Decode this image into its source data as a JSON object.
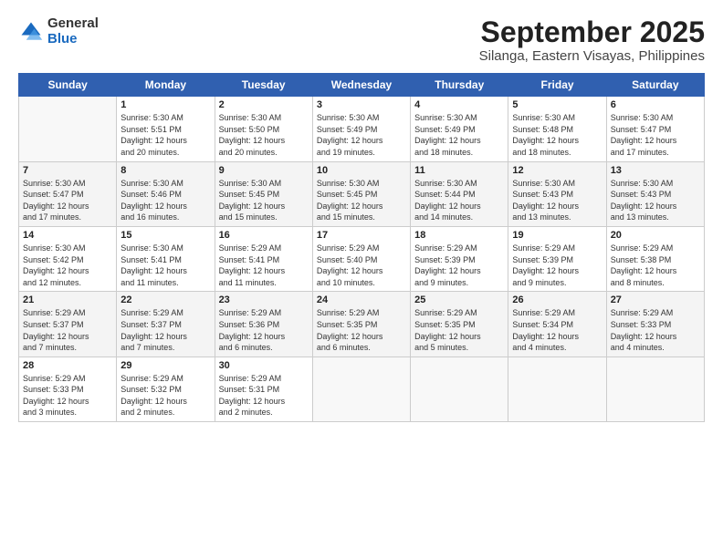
{
  "logo": {
    "general": "General",
    "blue": "Blue"
  },
  "title": "September 2025",
  "subtitle": "Silanga, Eastern Visayas, Philippines",
  "headers": [
    "Sunday",
    "Monday",
    "Tuesday",
    "Wednesday",
    "Thursday",
    "Friday",
    "Saturday"
  ],
  "weeks": [
    [
      {
        "day": "",
        "info": ""
      },
      {
        "day": "1",
        "info": "Sunrise: 5:30 AM\nSunset: 5:51 PM\nDaylight: 12 hours\nand 20 minutes."
      },
      {
        "day": "2",
        "info": "Sunrise: 5:30 AM\nSunset: 5:50 PM\nDaylight: 12 hours\nand 20 minutes."
      },
      {
        "day": "3",
        "info": "Sunrise: 5:30 AM\nSunset: 5:49 PM\nDaylight: 12 hours\nand 19 minutes."
      },
      {
        "day": "4",
        "info": "Sunrise: 5:30 AM\nSunset: 5:49 PM\nDaylight: 12 hours\nand 18 minutes."
      },
      {
        "day": "5",
        "info": "Sunrise: 5:30 AM\nSunset: 5:48 PM\nDaylight: 12 hours\nand 18 minutes."
      },
      {
        "day": "6",
        "info": "Sunrise: 5:30 AM\nSunset: 5:47 PM\nDaylight: 12 hours\nand 17 minutes."
      }
    ],
    [
      {
        "day": "7",
        "info": "Sunrise: 5:30 AM\nSunset: 5:47 PM\nDaylight: 12 hours\nand 17 minutes."
      },
      {
        "day": "8",
        "info": "Sunrise: 5:30 AM\nSunset: 5:46 PM\nDaylight: 12 hours\nand 16 minutes."
      },
      {
        "day": "9",
        "info": "Sunrise: 5:30 AM\nSunset: 5:45 PM\nDaylight: 12 hours\nand 15 minutes."
      },
      {
        "day": "10",
        "info": "Sunrise: 5:30 AM\nSunset: 5:45 PM\nDaylight: 12 hours\nand 15 minutes."
      },
      {
        "day": "11",
        "info": "Sunrise: 5:30 AM\nSunset: 5:44 PM\nDaylight: 12 hours\nand 14 minutes."
      },
      {
        "day": "12",
        "info": "Sunrise: 5:30 AM\nSunset: 5:43 PM\nDaylight: 12 hours\nand 13 minutes."
      },
      {
        "day": "13",
        "info": "Sunrise: 5:30 AM\nSunset: 5:43 PM\nDaylight: 12 hours\nand 13 minutes."
      }
    ],
    [
      {
        "day": "14",
        "info": "Sunrise: 5:30 AM\nSunset: 5:42 PM\nDaylight: 12 hours\nand 12 minutes."
      },
      {
        "day": "15",
        "info": "Sunrise: 5:30 AM\nSunset: 5:41 PM\nDaylight: 12 hours\nand 11 minutes."
      },
      {
        "day": "16",
        "info": "Sunrise: 5:29 AM\nSunset: 5:41 PM\nDaylight: 12 hours\nand 11 minutes."
      },
      {
        "day": "17",
        "info": "Sunrise: 5:29 AM\nSunset: 5:40 PM\nDaylight: 12 hours\nand 10 minutes."
      },
      {
        "day": "18",
        "info": "Sunrise: 5:29 AM\nSunset: 5:39 PM\nDaylight: 12 hours\nand 9 minutes."
      },
      {
        "day": "19",
        "info": "Sunrise: 5:29 AM\nSunset: 5:39 PM\nDaylight: 12 hours\nand 9 minutes."
      },
      {
        "day": "20",
        "info": "Sunrise: 5:29 AM\nSunset: 5:38 PM\nDaylight: 12 hours\nand 8 minutes."
      }
    ],
    [
      {
        "day": "21",
        "info": "Sunrise: 5:29 AM\nSunset: 5:37 PM\nDaylight: 12 hours\nand 7 minutes."
      },
      {
        "day": "22",
        "info": "Sunrise: 5:29 AM\nSunset: 5:37 PM\nDaylight: 12 hours\nand 7 minutes."
      },
      {
        "day": "23",
        "info": "Sunrise: 5:29 AM\nSunset: 5:36 PM\nDaylight: 12 hours\nand 6 minutes."
      },
      {
        "day": "24",
        "info": "Sunrise: 5:29 AM\nSunset: 5:35 PM\nDaylight: 12 hours\nand 6 minutes."
      },
      {
        "day": "25",
        "info": "Sunrise: 5:29 AM\nSunset: 5:35 PM\nDaylight: 12 hours\nand 5 minutes."
      },
      {
        "day": "26",
        "info": "Sunrise: 5:29 AM\nSunset: 5:34 PM\nDaylight: 12 hours\nand 4 minutes."
      },
      {
        "day": "27",
        "info": "Sunrise: 5:29 AM\nSunset: 5:33 PM\nDaylight: 12 hours\nand 4 minutes."
      }
    ],
    [
      {
        "day": "28",
        "info": "Sunrise: 5:29 AM\nSunset: 5:33 PM\nDaylight: 12 hours\nand 3 minutes."
      },
      {
        "day": "29",
        "info": "Sunrise: 5:29 AM\nSunset: 5:32 PM\nDaylight: 12 hours\nand 2 minutes."
      },
      {
        "day": "30",
        "info": "Sunrise: 5:29 AM\nSunset: 5:31 PM\nDaylight: 12 hours\nand 2 minutes."
      },
      {
        "day": "",
        "info": ""
      },
      {
        "day": "",
        "info": ""
      },
      {
        "day": "",
        "info": ""
      },
      {
        "day": "",
        "info": ""
      }
    ]
  ]
}
